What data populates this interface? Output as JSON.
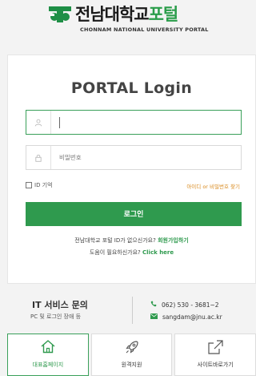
{
  "header": {
    "logo_text_main": "전남대학교",
    "logo_text_accent": "포털",
    "logo_subtitle": "CHONNAM NATIONAL UNIVERSITY PORTAL"
  },
  "login": {
    "title": "PORTAL Login",
    "username_placeholder": "",
    "password_placeholder": "비밀번호",
    "remember_label": "ID 기억",
    "find_link": "아이디 or 비밀번호 찾기",
    "login_button": "로그인",
    "signup_prompt": "전남대학교 포털 ID가 없으신가요?",
    "signup_link": "회원가입하기",
    "help_prompt": "도움이 필요하신가요?",
    "help_link": "Click here"
  },
  "service": {
    "title": "IT 서비스 문의",
    "subtitle": "PC 및 로그인 장애 등",
    "phone": "062) 530 - 3681~2",
    "email": "sangdam@jnu.ac.kr"
  },
  "menu": {
    "items": [
      {
        "label": "대표홈페이지",
        "icon": "home-icon"
      },
      {
        "label": "원격지원",
        "icon": "rocket-icon"
      },
      {
        "label": "사이트바로가기",
        "icon": "external-link-icon"
      }
    ]
  },
  "colors": {
    "accent": "#2f9a4e",
    "link_orange": "#d98a1e"
  }
}
